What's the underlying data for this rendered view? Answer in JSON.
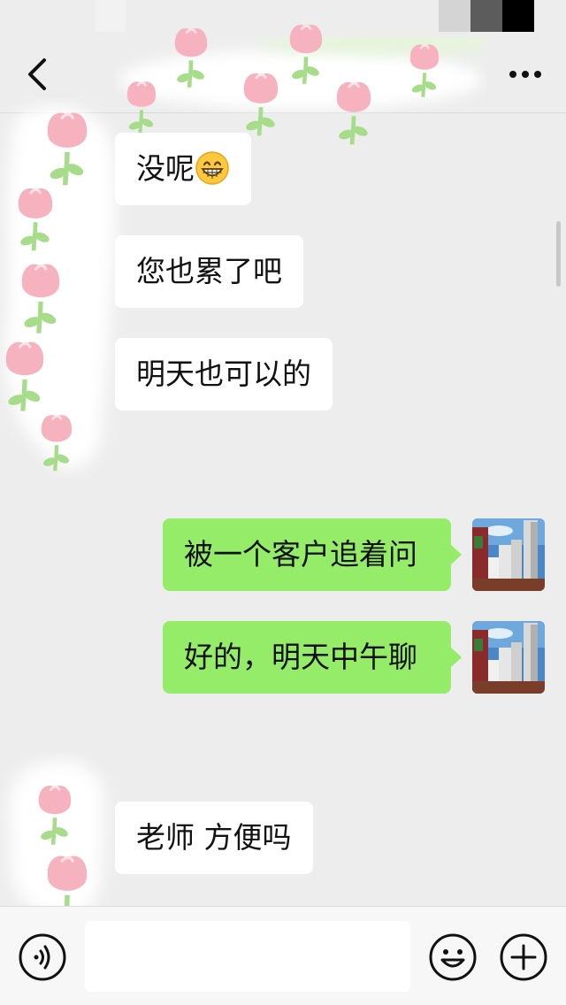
{
  "header": {
    "back_icon": "chevron-left-icon",
    "more_icon": "more-dots-icon"
  },
  "messages": [
    {
      "direction": "incoming",
      "text": "没呢",
      "emoji": "grinning-face-icon"
    },
    {
      "direction": "incoming",
      "text": "您也累了吧"
    },
    {
      "direction": "incoming",
      "text": "明天也可以的"
    },
    {
      "direction": "outgoing",
      "text": "被一个客户追着问",
      "avatar": "building-avatar"
    },
    {
      "direction": "outgoing",
      "text": "好的，明天中午聊",
      "avatar": "building-avatar"
    },
    {
      "direction": "incoming",
      "text": "老师 方便吗"
    }
  ],
  "input_bar": {
    "voice_icon": "voice-icon",
    "input_value": "",
    "emoji_icon": "emoji-icon",
    "plus_icon": "plus-icon"
  },
  "colors": {
    "background": "#ededed",
    "outgoing_bubble": "#95ec69",
    "incoming_bubble": "#ffffff",
    "tulip_pink": "#f6b3bf",
    "tulip_stem": "#a6dc8a"
  }
}
